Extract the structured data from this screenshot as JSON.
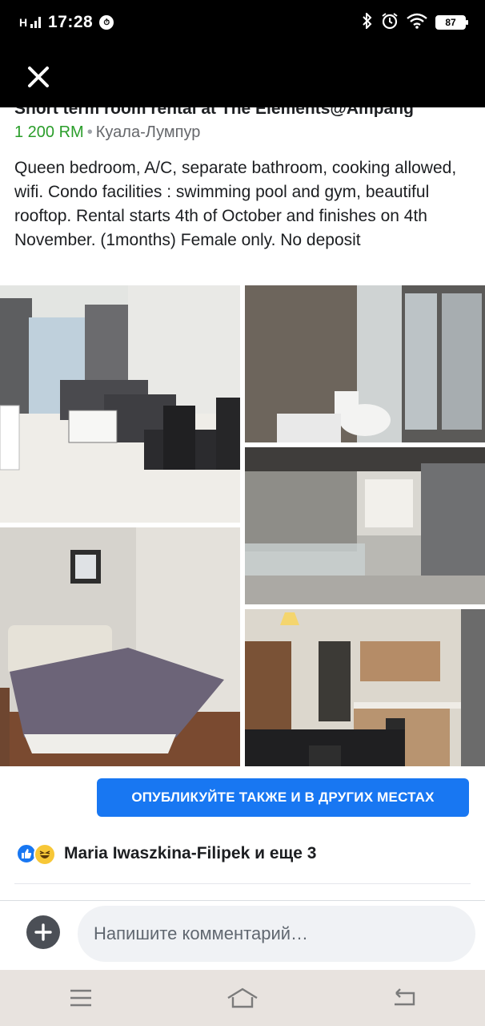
{
  "status_bar": {
    "signal": "H",
    "time": "17:28",
    "battery": "87"
  },
  "post": {
    "title": "Short term room rental at The Elements@Ampang",
    "price": "1 200 RM",
    "separator": "•",
    "location": "Куала-Лумпур",
    "description": "Queen bedroom, A/C, separate bathroom, cooking allowed, wifi. Condo facilities : swimming pool and gym, beautiful rooftop. Rental starts 4th of October and finishes on 4th November. (1months) Female only. No deposit"
  },
  "actions": {
    "publish_label": "ОПУБЛИКУЙТЕ ТАКЖЕ И В ДРУГИХ МЕСТАХ"
  },
  "reactions": {
    "text": "Maria Iwaszkina-Filipek и еще 3"
  },
  "comment": {
    "placeholder": "Напишите комментарий…"
  }
}
